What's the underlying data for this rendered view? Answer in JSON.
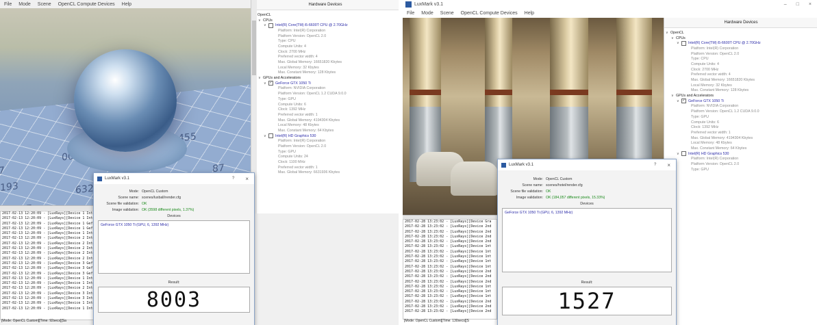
{
  "left": {
    "menu": [
      "File",
      "Mode",
      "Scene",
      "OpenCL Compute Devices",
      "Help"
    ],
    "floor_numbers": [
      "193",
      "027",
      "455",
      "632",
      "185",
      "007",
      "117",
      "87"
    ],
    "hardware": {
      "header": "Hardware Devices",
      "root": "OpenCL",
      "cpus": "CPUs",
      "cpu_device": "Intel(R) Core(TM) i5-6600T CPU @ 2.70GHz",
      "cpu_props": [
        "Platform: Intel(R) Corporation",
        "Platform Version: OpenCL 2.0",
        "Type: CPU",
        "Compute Units: 4",
        "Clock: 2700 MHz",
        "Preferred vector width: 4",
        "Max. Global Memory: 16651820 Kbytes",
        "Local Memory: 32 Kbytes",
        "Max. Constant Memory: 128 Kbytes"
      ],
      "gpus": "GPUs and Accelerators",
      "gpu_device": "GeForce GTX 1050 Ti",
      "gpu_props": [
        "Platform: NVIDIA Corporation",
        "Platform Version: OpenCL 1.2 CUDA 9.0.0",
        "Type: GPU",
        "Compute Units: 6",
        "Clock: 1392 MHz",
        "Preferred vector width: 1",
        "Max. Global Memory: 4194304 Kbytes",
        "Local Memory: 48 Kbytes",
        "Max. Constant Memory: 64 Kbytes"
      ],
      "igpu_device": "Intel(R) HD Graphics 530",
      "igpu_props": [
        "Platform: Intel(R) Corporation",
        "Platform Version: OpenCL 2.0",
        "Type: GPU",
        "Compute Units: 24",
        "Clock: 1100 MHz",
        "Preferred vector width: 1",
        "Max. Global Memory: 6631936 Kbytes"
      ]
    },
    "log_lines": [
      "2017-02-13 12:20:09 - [LuxRays][Device 1 Intel",
      "2017-02-13 12:20:09 - [LuxRays][Device 1 Intel",
      "2017-02-13 12:20:09 - [LuxRays][Device 1 Gef",
      "2017-02-13 12:20:09 - [LuxRays][Device 1 Gef",
      "2017-02-13 12:20:09 - [LuxRays][Device 1 Intel",
      "2017-02-13 12:20:09 - [LuxRays][Device 2 Intel",
      "2017-02-13 12:20:09 - [LuxRays][Device 2 Intel",
      "2017-02-13 12:20:09 - [LuxRays][Device 2 Intel",
      "2017-02-13 12:20:09 - [LuxRays][Device 2 Intel",
      "2017-02-13 12:20:09 - [LuxRays][Device 2 Intel",
      "2017-02-13 12:20:09 - [LuxRays][Device 3 Gef",
      "2017-02-13 12:20:09 - [LuxRays][Device 3 Gef",
      "2017-02-13 12:20:09 - [LuxRays][Device 3 Gef",
      "2017-02-13 12:20:09 - [LuxRays][Device 1 Intel",
      "2017-02-13 12:20:09 - [LuxRays][Device 1 Intel",
      "2017-02-13 12:20:09 - [LuxRays][Device 2 Intel",
      "2017-02-13 12:20:09 - [LuxRays][Device 3 Intel",
      "2017-02-13 12:20:09 - [LuxRays][Device 3 Intel",
      "2017-02-13 12:20:09 - [LuxRays][Device 1 Intel",
      "2017-02-13 12:20:09 - [LuxRays][Device 1 Intel"
    ],
    "status": "[Mode: OpenCL Custom][Time: 92secs][Sa",
    "dialog": {
      "title": "LuxMark v3.1",
      "help": "?",
      "close": "×",
      "mode_label": "Mode:",
      "mode_value": "OpenCL Custom",
      "scene_label": "Scene name:",
      "scene_value": "scenes/luxball/render.cfg",
      "scenefile_label": "Scene file validation:",
      "scenefile_value": "OK",
      "image_label": "Image validation:",
      "image_value": "OK (3598 different pixels, 1.37%)",
      "devices_label": "Devices",
      "devices_value": "GeForce GTX 1050 Ti (GPU, 6, 1392 MHz)",
      "result_label": "Result:",
      "result_value": "8003"
    }
  },
  "right": {
    "window_title": "LuxMark v3.1",
    "window_buttons": [
      "–",
      "□",
      "×"
    ],
    "menu": [
      "File",
      "Mode",
      "Scene",
      "OpenCL Compute Devices",
      "Help"
    ],
    "hardware": {
      "header": "Hardware Devices",
      "root": "OpenCL",
      "cpus": "CPUs",
      "cpu_device": "Intel(R) Core(TM) i5-6600T CPU @ 2.70GHz",
      "cpu_props": [
        "Platform: Intel(R) Corporation",
        "Platform Version: OpenCL 2.0",
        "Type: CPU",
        "Compute Units: 4",
        "Clock: 2700 MHz",
        "Preferred vector width: 4",
        "Max. Global Memory: 16651820 Kbytes",
        "Local Memory: 32 Kbytes",
        "Max. Constant Memory: 128 Kbytes"
      ],
      "gpus": "GPUs and Accelerators",
      "gpu_device": "GeForce GTX 1050 Ti",
      "gpu_props": [
        "Platform: NVIDIA Corporation",
        "Platform Version: OpenCL 1.2 CUDA 9.0.0",
        "Type: GPU",
        "Compute Units: 6",
        "Clock: 1392 MHz",
        "Preferred vector width: 1",
        "Max. Global Memory: 4194304 Kbytes",
        "Local Memory: 48 Kbytes",
        "Max. Constant Memory: 64 Kbytes"
      ],
      "igpu_device": "Intel(R) HD Graphics 530",
      "igpu_props": [
        "Platform: Intel(R) Corporation",
        "Platform Version: OpenCL 2.0",
        "Type: GPU"
      ]
    },
    "log_lines": [
      "2017-02-28 13:23:02 - [LuxRays][Device Gra",
      "2017-02-28 13:23:02 - [LuxRays][Device 2nd",
      "2017-02-28 13:23:02 - [LuxRays][Device 2nd",
      "2017-02-28 13:23:02 - [LuxRays][Device 2nd",
      "2017-02-28 13:23:02 - [LuxRays][Device 2nd",
      "2017-02-28 13:23:02 - [LuxRays][Device 1nt",
      "2017-02-28 13:23:02 - [LuxRays][Device 1nt",
      "2017-02-28 13:23:02 - [LuxRays][Device 1nt",
      "2017-02-28 13:23:02 - [LuxRays][Device 1nt",
      "2017-02-28 13:23:02 - [LuxRays][Device 1nt",
      "2017-02-28 13:23:02 - [LuxRays][Device 2nd",
      "2017-02-28 13:23:02 - [LuxRays][Device 2nd",
      "2017-02-28 13:23:02 - [LuxRays][Device 2nd",
      "2017-02-28 13:23:02 - [LuxRays][Device 1nt",
      "2017-02-28 13:23:02 - [LuxRays][Device 1nt",
      "2017-02-28 13:23:02 - [LuxRays][Device 1nt",
      "2017-02-28 13:23:02 - [LuxRays][Device 2nd",
      "2017-02-28 13:23:02 - [LuxRays][Device 2nd",
      "2017-02-28 13:23:02 - [LuxRays][Device 2nd"
    ],
    "status": "[Mode: OpenCL Custom][Time: 130secs][S",
    "dialog": {
      "title": "LuxMark v3.1",
      "help": "?",
      "close": "×",
      "mode_label": "Mode:",
      "mode_value": "OpenCL Custom",
      "scene_label": "Scene name:",
      "scene_value": "scenes/hotel/render.cfg",
      "scenefile_label": "Scene file validation:",
      "scenefile_value": "OK",
      "image_label": "Image validation:",
      "image_value": "OK (184,057 different pixels, 15.33%)",
      "devices_label": "Devices",
      "devices_value": "GeForce GTX 1050 Ti (GPU, 6, 1392 MHz)",
      "result_label": "Result:",
      "result_value": "1527"
    }
  }
}
